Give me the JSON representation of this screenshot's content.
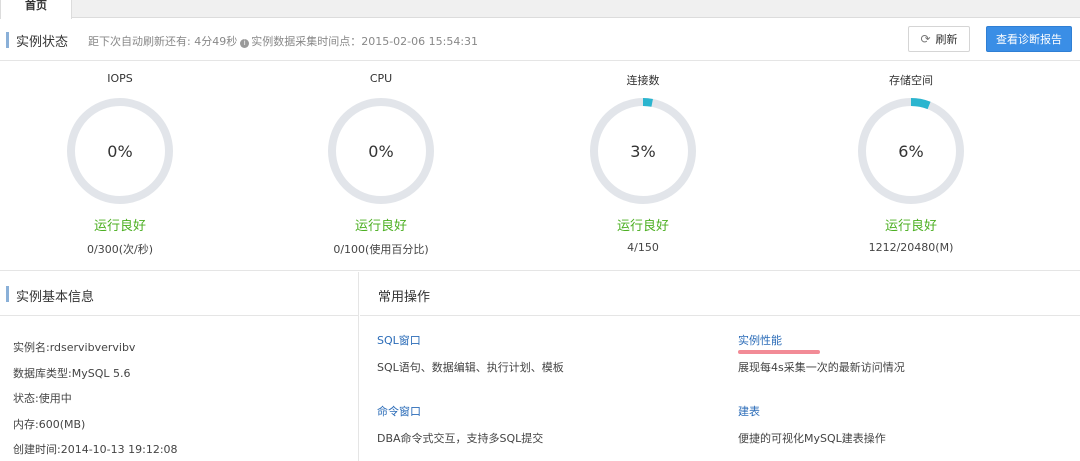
{
  "tab": {
    "home": "首页"
  },
  "status": {
    "title": "实例状态",
    "refresh_prefix": "距下次自动刷新还有: 4分49秒",
    "collect_time": "实例数据采集时间点：2015-02-06 15:54:31",
    "refresh_button": "刷新",
    "report_button": "查看诊断报告"
  },
  "gauges": [
    {
      "label": "IOPS",
      "value": "0%",
      "percent": 0,
      "status": "运行良好",
      "detail": "0/300(次/秒)"
    },
    {
      "label": "CPU",
      "value": "0%",
      "percent": 0,
      "status": "运行良好",
      "detail": "0/100(使用百分比)"
    },
    {
      "label": "连接数",
      "value": "3%",
      "percent": 3,
      "status": "运行良好",
      "detail": "4/150"
    },
    {
      "label": "存储空间",
      "value": "6%",
      "percent": 6,
      "status": "运行良好",
      "detail": "1212/20480(M)"
    }
  ],
  "colors": {
    "ring_track": "#e2e5ea",
    "ring_fill": "#2bb5cf",
    "status_good": "#4caf22",
    "accent": "#3a8ee6"
  },
  "basic_info": {
    "title": "实例基本信息",
    "rows": [
      "实例名:rdservibvervibv",
      "数据库类型:MySQL 5.6",
      "状态:使用中",
      "内存:600(MB)",
      "创建时间:2014-10-13 19:12:08"
    ]
  },
  "ops": {
    "title": "常用操作",
    "items": [
      {
        "title": "SQL窗口",
        "desc": "SQL语句、数据编辑、执行计划、模板"
      },
      {
        "title": "实例性能",
        "desc": "展现每4s采集一次的最新访问情况"
      },
      {
        "title": "命令窗口",
        "desc": "DBA命令式交互，支持多SQL提交"
      },
      {
        "title": "建表",
        "desc": "便捷的可视化MySQL建表操作"
      }
    ]
  }
}
